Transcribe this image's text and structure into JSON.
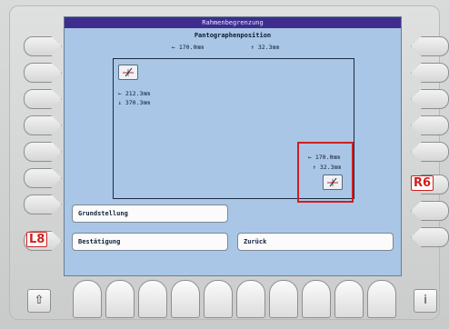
{
  "screen": {
    "title": "Rahmenbegrenzung",
    "subtitle": "Pantographenposition",
    "position_x": "← 170.0mm",
    "position_y": "↑ 32.3mm"
  },
  "frame": {
    "top_left_x": "← 212.3mm",
    "top_left_y": "↓ 370.3mm",
    "bottom_right_x": "← 170.0mm",
    "bottom_right_y": "↑ 32.3mm"
  },
  "buttons": {
    "grundstellung": "Grundstellung",
    "bestaetigung": "Bestätigung",
    "zurueck": "Zurück"
  },
  "softkey_labels": {
    "left_8": "L8",
    "right_6": "R6"
  },
  "corner_keys": {
    "left_icon": "⇧",
    "right_icon": "i"
  },
  "colors": {
    "screen_bg": "#a9c6e6",
    "titlebar": "#3e2d8f",
    "highlight": "#d01f1f"
  }
}
